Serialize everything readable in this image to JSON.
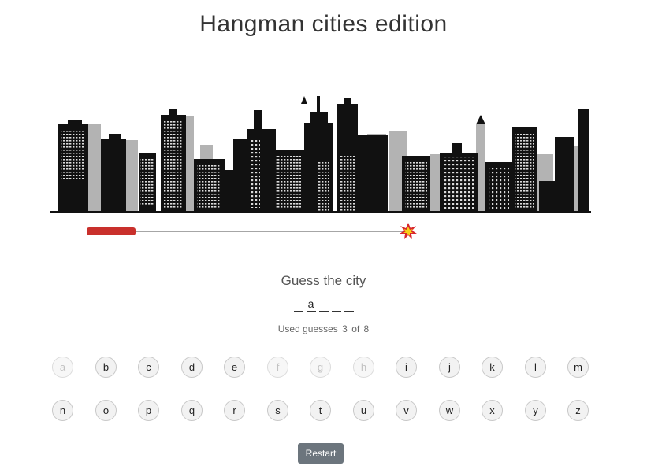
{
  "header": {
    "title": "Hangman cities edition"
  },
  "game": {
    "prompt": "Guess the city",
    "word_slots": [
      "",
      "a",
      "",
      "",
      ""
    ],
    "used_text": "Used guesses",
    "used_count": "3",
    "of_text": "of",
    "max_count": "8",
    "fuse_remaining_fraction": 0.62
  },
  "keyboard": {
    "row1": [
      {
        "letter": "a",
        "used": true
      },
      {
        "letter": "b",
        "used": false
      },
      {
        "letter": "c",
        "used": false
      },
      {
        "letter": "d",
        "used": false
      },
      {
        "letter": "e",
        "used": false
      },
      {
        "letter": "f",
        "used": true
      },
      {
        "letter": "g",
        "used": true
      },
      {
        "letter": "h",
        "used": true
      },
      {
        "letter": "i",
        "used": false
      },
      {
        "letter": "j",
        "used": false
      },
      {
        "letter": "k",
        "used": false
      },
      {
        "letter": "l",
        "used": false
      },
      {
        "letter": "m",
        "used": false
      }
    ],
    "row2": [
      {
        "letter": "n",
        "used": false
      },
      {
        "letter": "o",
        "used": false
      },
      {
        "letter": "p",
        "used": false
      },
      {
        "letter": "q",
        "used": false
      },
      {
        "letter": "r",
        "used": false
      },
      {
        "letter": "s",
        "used": false
      },
      {
        "letter": "t",
        "used": false
      },
      {
        "letter": "u",
        "used": false
      },
      {
        "letter": "v",
        "used": false
      },
      {
        "letter": "w",
        "used": false
      },
      {
        "letter": "x",
        "used": false
      },
      {
        "letter": "y",
        "used": false
      },
      {
        "letter": "z",
        "used": false
      }
    ]
  },
  "controls": {
    "restart_label": "Restart"
  },
  "colors": {
    "fuse_red": "#c9302c",
    "restart_bg": "#6c757d"
  }
}
